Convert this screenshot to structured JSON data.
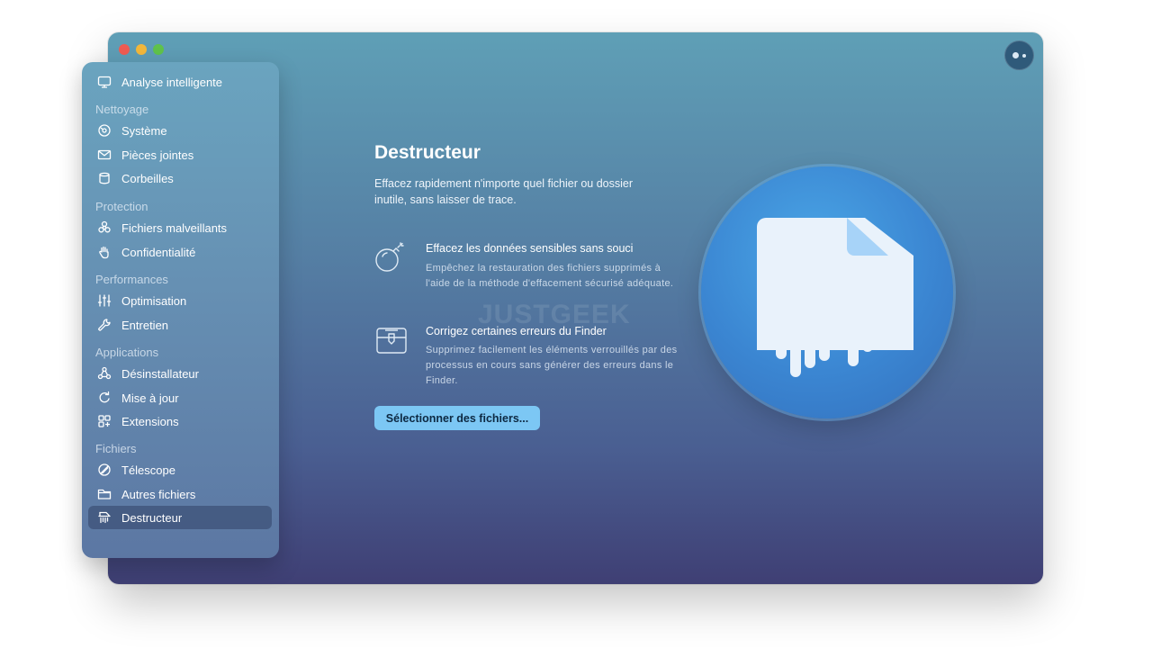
{
  "window": {
    "assistant_icon": "assistant-icon",
    "traffic_colors": {
      "close": "#ee5b52",
      "minimize": "#f2b73a",
      "zoom": "#5fc24a"
    }
  },
  "sidebar": {
    "top_item": {
      "label": "Analyse intelligente",
      "icon": "monitor-icon"
    },
    "sections": [
      {
        "title": "Nettoyage",
        "items": [
          {
            "label": "Système",
            "icon": "disk-icon"
          },
          {
            "label": "Pièces jointes",
            "icon": "mail-icon"
          },
          {
            "label": "Corbeilles",
            "icon": "trash-icon"
          }
        ]
      },
      {
        "title": "Protection",
        "items": [
          {
            "label": "Fichiers malveillants",
            "icon": "biohazard-icon"
          },
          {
            "label": "Confidentialité",
            "icon": "hand-icon"
          }
        ]
      },
      {
        "title": "Performances",
        "items": [
          {
            "label": "Optimisation",
            "icon": "sliders-icon"
          },
          {
            "label": "Entretien",
            "icon": "wrench-icon"
          }
        ]
      },
      {
        "title": "Applications",
        "items": [
          {
            "label": "Désinstallateur",
            "icon": "uninstaller-icon"
          },
          {
            "label": "Mise à jour",
            "icon": "update-icon"
          },
          {
            "label": "Extensions",
            "icon": "extensions-icon"
          }
        ]
      },
      {
        "title": "Fichiers",
        "items": [
          {
            "label": "Télescope",
            "icon": "telescope-icon"
          },
          {
            "label": "Autres fichiers",
            "icon": "folder-icon"
          },
          {
            "label": "Destructeur",
            "icon": "shredder-icon",
            "selected": true
          }
        ]
      }
    ]
  },
  "main": {
    "title": "Destructeur",
    "description": "Effacez rapidement n'importe quel fichier ou dossier inutile, sans laisser de trace.",
    "features": [
      {
        "icon": "bomb-icon",
        "title": "Effacez les données sensibles sans souci",
        "description": "Empêchez la restauration des fichiers supprimés à l'aide de la méthode d'effacement sécurisé adéquate."
      },
      {
        "icon": "unlock-chest-icon",
        "title": "Corrigez certaines erreurs du Finder",
        "description": "Supprimez facilement les éléments verrouillés par des processus en cours sans générer des erreurs dans le Finder."
      }
    ],
    "button_label": "Sélectionner des fichiers...",
    "watermark": "JUSTGEEK",
    "hero_icon": "shredded-file-icon",
    "colors": {
      "button": "#7cc7f4",
      "hero_circle": "#3b86d2",
      "selected_item": "#37486e"
    }
  }
}
